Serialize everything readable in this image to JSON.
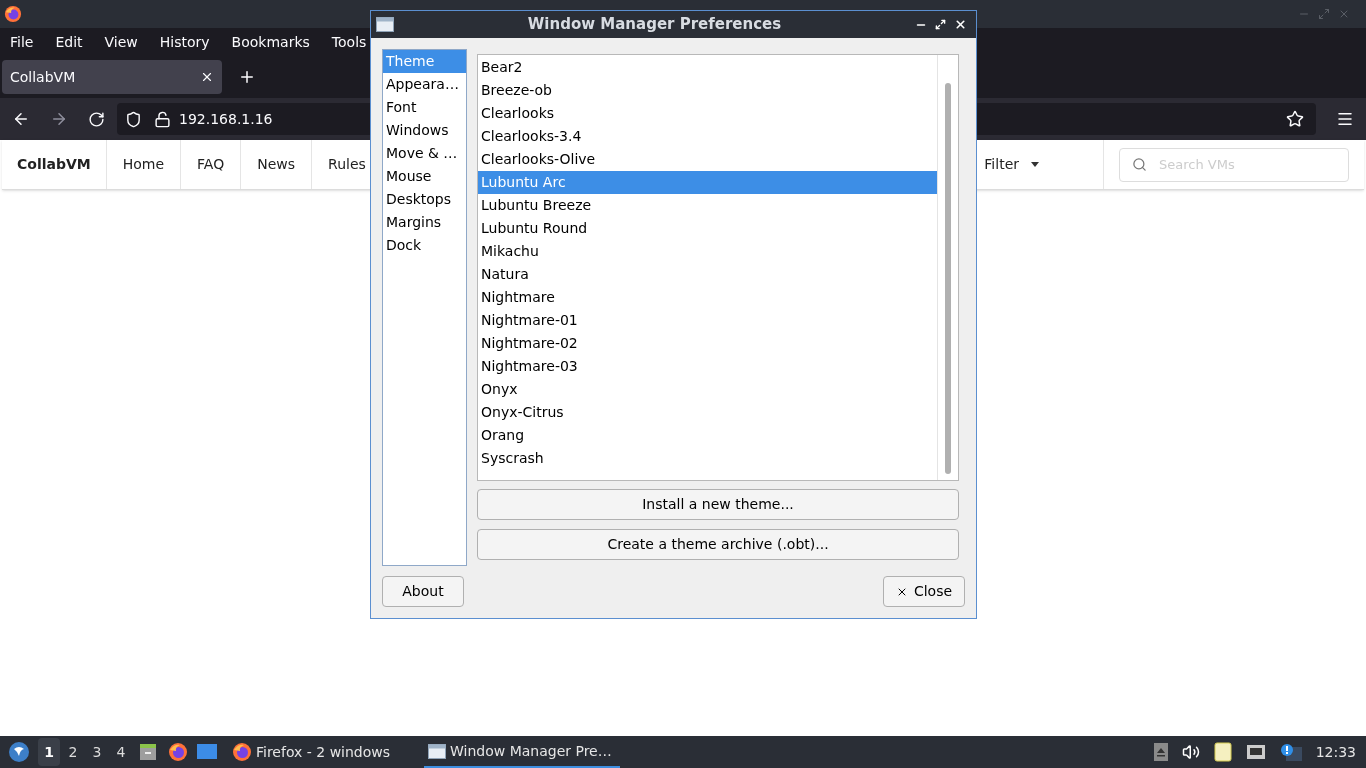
{
  "browser": {
    "menu": [
      "File",
      "Edit",
      "View",
      "History",
      "Bookmarks",
      "Tools"
    ],
    "tab": {
      "label": "CollabVM"
    },
    "url": "192.168.1.16",
    "site_nav": {
      "brand": "CollabVM",
      "links": [
        "Home",
        "FAQ",
        "News",
        "Rules"
      ],
      "filter": "Filter",
      "search": {
        "placeholder": "Search VMs"
      }
    }
  },
  "dialog": {
    "title": "Window Manager Preferences",
    "sections": [
      {
        "label": "Theme",
        "selected": true
      },
      {
        "label": "Appeara…",
        "selected": false
      },
      {
        "label": "Font",
        "selected": false
      },
      {
        "label": "Windows",
        "selected": false
      },
      {
        "label": "Move & …",
        "selected": false
      },
      {
        "label": "Mouse",
        "selected": false
      },
      {
        "label": "Desktops",
        "selected": false
      },
      {
        "label": "Margins",
        "selected": false
      },
      {
        "label": "Dock",
        "selected": false
      }
    ],
    "themes": [
      {
        "label": "Bear2",
        "selected": false
      },
      {
        "label": "Breeze-ob",
        "selected": false
      },
      {
        "label": "Clearlooks",
        "selected": false
      },
      {
        "label": "Clearlooks-3.4",
        "selected": false
      },
      {
        "label": "Clearlooks-Olive",
        "selected": false
      },
      {
        "label": "Lubuntu Arc",
        "selected": true
      },
      {
        "label": "Lubuntu Breeze",
        "selected": false
      },
      {
        "label": "Lubuntu Round",
        "selected": false
      },
      {
        "label": "Mikachu",
        "selected": false
      },
      {
        "label": "Natura",
        "selected": false
      },
      {
        "label": "Nightmare",
        "selected": false
      },
      {
        "label": "Nightmare-01",
        "selected": false
      },
      {
        "label": "Nightmare-02",
        "selected": false
      },
      {
        "label": "Nightmare-03",
        "selected": false
      },
      {
        "label": "Onyx",
        "selected": false
      },
      {
        "label": "Onyx-Citrus",
        "selected": false
      },
      {
        "label": "Orang",
        "selected": false
      },
      {
        "label": "Syscrash",
        "selected": false
      }
    ],
    "actions": [
      "Install a new theme...",
      "Create a theme archive (.obt)..."
    ],
    "about": "About",
    "close": "Close"
  },
  "taskbar": {
    "workspaces": [
      {
        "label": "1",
        "selected": true
      },
      {
        "label": "2",
        "selected": false
      },
      {
        "label": "3",
        "selected": false
      },
      {
        "label": "4",
        "selected": false
      }
    ],
    "tasks": [
      {
        "label": "Firefox - 2 windows",
        "kind": "firefox",
        "selected": false
      },
      {
        "label": "Window Manager Pre…",
        "kind": "window",
        "selected": true
      }
    ],
    "clock": "12:33"
  }
}
